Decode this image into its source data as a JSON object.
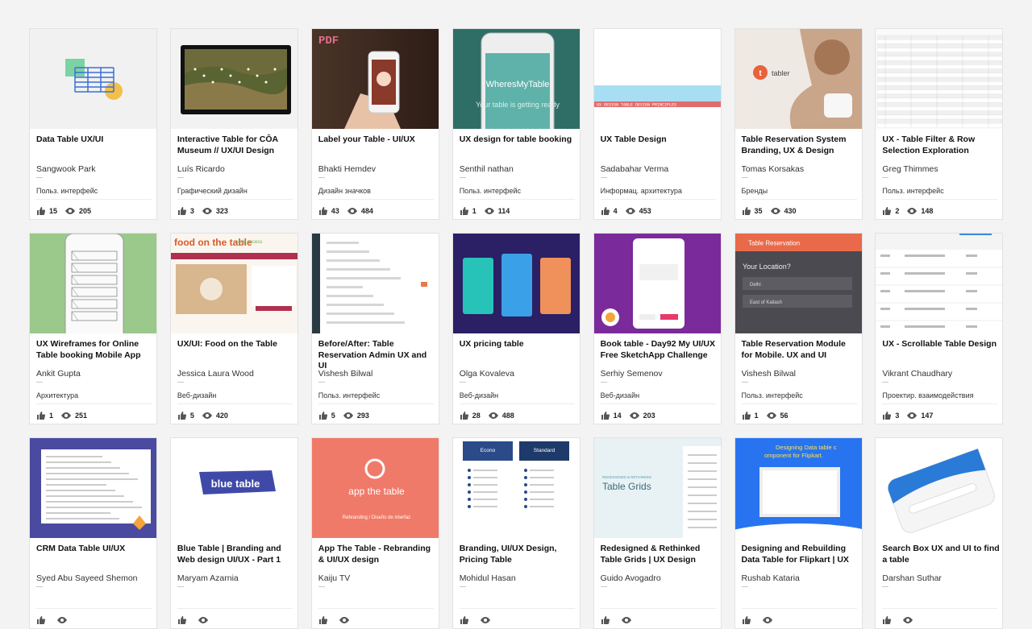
{
  "cards": [
    {
      "title": "Data Table UX/UI",
      "author": "Sangwook Park",
      "field": "Польз. интерфейс",
      "likes": "15",
      "views": "205",
      "thumb": "data-table"
    },
    {
      "title": "Interactive Table for CÔA Museum // UX/UI Design",
      "author": "Luís Ricardo",
      "field": "Графический дизайн",
      "likes": "3",
      "views": "323",
      "thumb": "museum-table"
    },
    {
      "title": "Label your Table - UI/UX",
      "author": "Bhakti Hemdev",
      "field": "Дизайн значков",
      "likes": "43",
      "views": "484",
      "thumb": "phone-hand",
      "thumb_text": "PDF"
    },
    {
      "title": "UX design for table booking",
      "author": "Senthil nathan",
      "field": "Польз. интерфейс",
      "likes": "1",
      "views": "114",
      "thumb": "wheresmytable",
      "thumb_text": "WheresMyTable",
      "thumb_sub": "Your table is getting ready"
    },
    {
      "title": "UX Table Design",
      "author": "Sadabahar Verma",
      "field": "Информац. архитектура",
      "likes": "4",
      "views": "453",
      "thumb": "ux-table",
      "thumb_text": "UX DESIGN TABLE DESIGN PRINCIPLES"
    },
    {
      "title": "Table Reservation System Branding, UX & Design",
      "author": "Tomas Korsakas",
      "field": "Бренды",
      "likes": "35",
      "views": "430",
      "thumb": "tabler",
      "thumb_text": "tabler"
    },
    {
      "title": "UX - Table Filter & Row Selection Exploration",
      "author": "Greg Thimmes",
      "field": "Польз. интерфейс",
      "likes": "2",
      "views": "148",
      "thumb": "filter-table"
    },
    {
      "title": "UX Wireframes for Online Table booking Mobile App",
      "author": "Ankit Gupta",
      "field": "Архитектура",
      "likes": "1",
      "views": "251",
      "thumb": "wireframe"
    },
    {
      "title": "UX/UI: Food on the Table",
      "author": "Jessica Laura Wood",
      "field": "Веб-дизайн",
      "likes": "5",
      "views": "420",
      "thumb": "food",
      "thumb_text": "food on the table",
      "thumb_sub": "early access"
    },
    {
      "title": "Before/After: Table Reservation Admin UX and UI",
      "author": "Vishesh Bilwal",
      "field": "Польз. интерфейс",
      "likes": "5",
      "views": "293",
      "thumb": "admin"
    },
    {
      "title": "UX pricing table",
      "author": "Olga Kovaleva",
      "field": "Веб-дизайн",
      "likes": "28",
      "views": "488",
      "thumb": "pricing"
    },
    {
      "title": "Book table - Day92 My UI/UX Free SketchApp Challenge",
      "author": "Serhiy Semenov",
      "field": "Веб-дизайн",
      "likes": "14",
      "views": "203",
      "thumb": "booktable"
    },
    {
      "title": "Table Reservation Module for Mobile. UX and UI",
      "author": "Vishesh Bilwal",
      "field": "Польз. интерфейс",
      "likes": "1",
      "views": "56",
      "thumb": "reservation",
      "thumb_text": "Table Reservation",
      "thumb_sub": "Your Location?",
      "thumb_items": [
        "Delhi",
        "East of Kailash"
      ]
    },
    {
      "title": "UX - Scrollable Table Design",
      "author": "Vikrant Chaudhary",
      "field": "Проектир. взаимодействия",
      "likes": "3",
      "views": "147",
      "thumb": "scrollable"
    },
    {
      "title": "CRM Data Table UI/UX",
      "author": "Syed Abu Sayeed Shemon",
      "field": "",
      "likes": "",
      "views": "",
      "thumb": "crm"
    },
    {
      "title": "Blue Table | Branding and Web design UI/UX - Part 1",
      "author": "Maryam Azarnia",
      "field": "",
      "likes": "",
      "views": "",
      "thumb": "bluetable",
      "thumb_text": "blue table"
    },
    {
      "title": "App The Table - Rebranding & UI/UX design",
      "author": "Kaiju TV",
      "field": "",
      "likes": "",
      "views": "",
      "thumb": "apptable",
      "thumb_text": "app the table",
      "thumb_sub": "Rebranding / Diseño de interfaz"
    },
    {
      "title": "Branding, UI/UX Design, Pricing Table",
      "author": "Mohidul Hasan",
      "field": "",
      "likes": "",
      "views": "",
      "thumb": "pricing2",
      "thumb_text": "Econo",
      "thumb_sub": "Standard"
    },
    {
      "title": "Redesigned & Rethinked Table Grids | UX Design",
      "author": "Guido Avogadro",
      "field": "",
      "likes": "",
      "views": "",
      "thumb": "tablegrids",
      "thumb_text": "Table Grids",
      "thumb_sub": "REDESIGNED & RETHINKED"
    },
    {
      "title": "Designing and Rebuilding Data Table for Flipkart | UX",
      "author": "Rushab Kataria",
      "field": "",
      "likes": "",
      "views": "",
      "thumb": "flipkart",
      "thumb_text": "Designing Data table component for Flipkart."
    },
    {
      "title": "Search Box UX and UI to find a table",
      "author": "Darshan Suthar",
      "field": "",
      "likes": "",
      "views": "",
      "thumb": "searchbox"
    }
  ],
  "icons": {
    "like": "thumbs-up-icon",
    "view": "eye-icon"
  }
}
